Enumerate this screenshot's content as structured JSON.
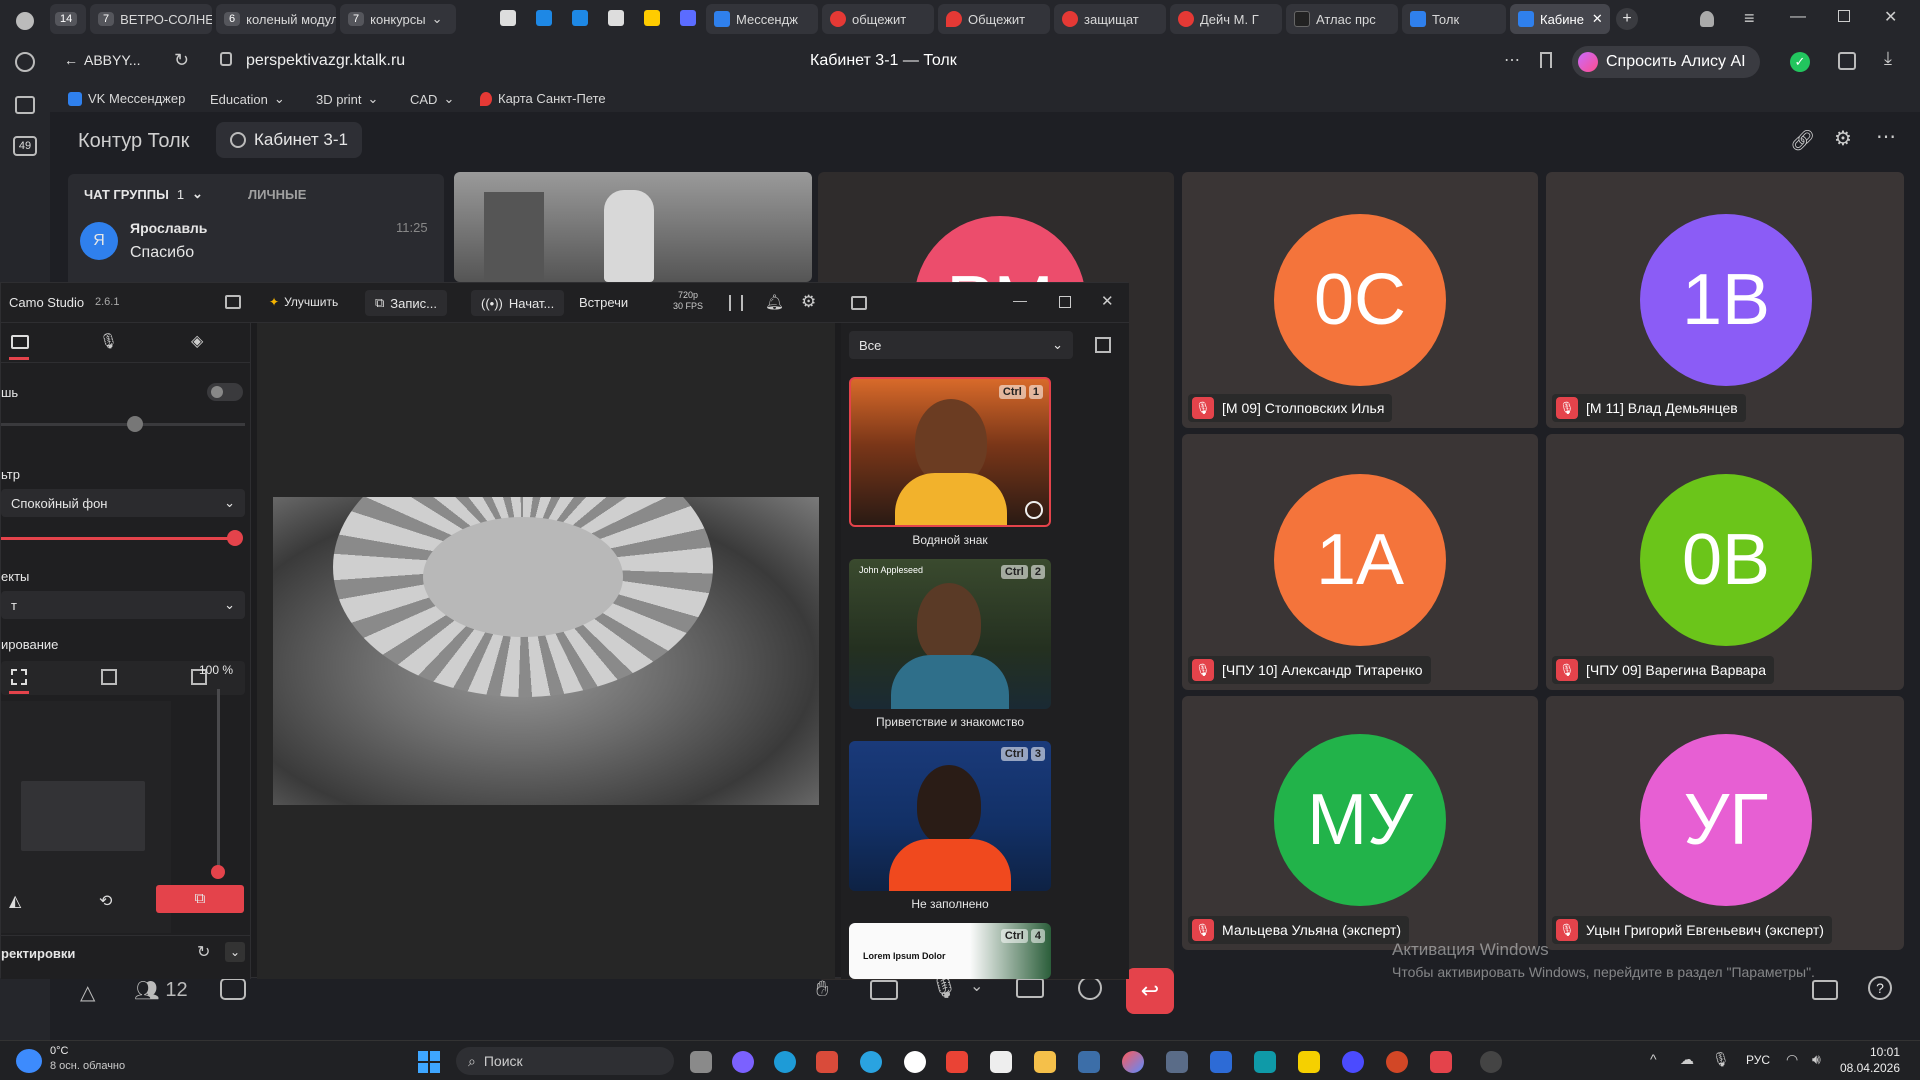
{
  "browser": {
    "tabs": [
      {
        "num": "14",
        "label": ""
      },
      {
        "num": "7",
        "label": "ВЕТРО-СОЛНЕ"
      },
      {
        "num": "6",
        "label": "коленый модул"
      },
      {
        "num": "7",
        "label": "конкурсы"
      },
      {
        "label": "Мессендж"
      },
      {
        "label": "общежит"
      },
      {
        "label": "Общежит"
      },
      {
        "label": "защищат"
      },
      {
        "label": "Дейч М. Г"
      },
      {
        "label": "Атлас прс"
      },
      {
        "label": "Толк"
      },
      {
        "label": "Кабине"
      }
    ],
    "back_label": "ABBYY...",
    "url": "perspektivazgr.ktalk.ru",
    "page_title": "Кабинет 3-1 — Толк",
    "alice_label": "Спросить Алису AI",
    "sidebar_badge": "49",
    "bookmarks": [
      "VK Мессенджер",
      "Education",
      "3D print",
      "CAD",
      "Карта Санкт-Пете"
    ]
  },
  "talk": {
    "app_name": "Контур Толк",
    "room_name": "Кабинет 3-1",
    "chat": {
      "tab_group": "ЧАТ ГРУППЫ",
      "group_count": "1",
      "tab_personal": "ЛИЧНЫЕ",
      "message": {
        "avatar_letter": "Я",
        "author": "Ярославль",
        "time": "11:25",
        "text": "Спасибо"
      }
    },
    "participants": [
      {
        "initials": "0С",
        "name": "[М 09] Столповских Илья",
        "color": "#f4743b"
      },
      {
        "initials": "1В",
        "name": "[М 11] Влад Демьянцев",
        "color": "#8b5cf6"
      },
      {
        "initials": "1А",
        "name": "[ЧПУ 10] Александр Титаренко",
        "color": "#f4743b"
      },
      {
        "initials": "0В",
        "name": "[ЧПУ 09] Варегина Варвара",
        "color": "#6bc51a"
      },
      {
        "initials": "МУ",
        "name": "Мальцева Ульяна (эксперт)",
        "color": "#22b34a"
      },
      {
        "initials": "УГ",
        "name": "Уцын Григорий Евгеньевич (эксперт)",
        "color": "#e75fd3"
      }
    ],
    "partial_avatar": "РМ",
    "participant_count": "12",
    "watermark_title": "Активация Windows",
    "watermark_text": "Чтобы активировать Windows, перейдите в раздел \"Параметры\"."
  },
  "camo": {
    "title": "Camo Studio",
    "version": "2.6.1",
    "improve": "Улучшить",
    "record": "Запис...",
    "stream": "Начат...",
    "meetings": "Встречи",
    "resolution": "720p",
    "fps": "30 FPS",
    "labels": {
      "blur": "шь",
      "filter": "ьтр",
      "filter_value": "Спокойный фон",
      "effects": "екты",
      "effects_value": "т",
      "framing": "ирование",
      "zoom": "100 %",
      "adjust": "ректировки"
    },
    "filter_select": "Все",
    "presets": [
      {
        "label": "Водяной знак",
        "key": "1"
      },
      {
        "label": "Приветствие и знакомство",
        "key": "2",
        "overlay_name": "John Appleseed"
      },
      {
        "label": "Не заполнено",
        "key": "3"
      },
      {
        "label": "",
        "key": "4",
        "overlay_title": "Lorem Ipsum Dolor"
      }
    ],
    "ctrl_label": "Ctrl"
  },
  "taskbar": {
    "weather_temp": "0°C",
    "weather_desc": "8 осн. облачно",
    "search": "Поиск",
    "lang": "РУС",
    "time": "10:01",
    "date": "08.04.2026"
  }
}
